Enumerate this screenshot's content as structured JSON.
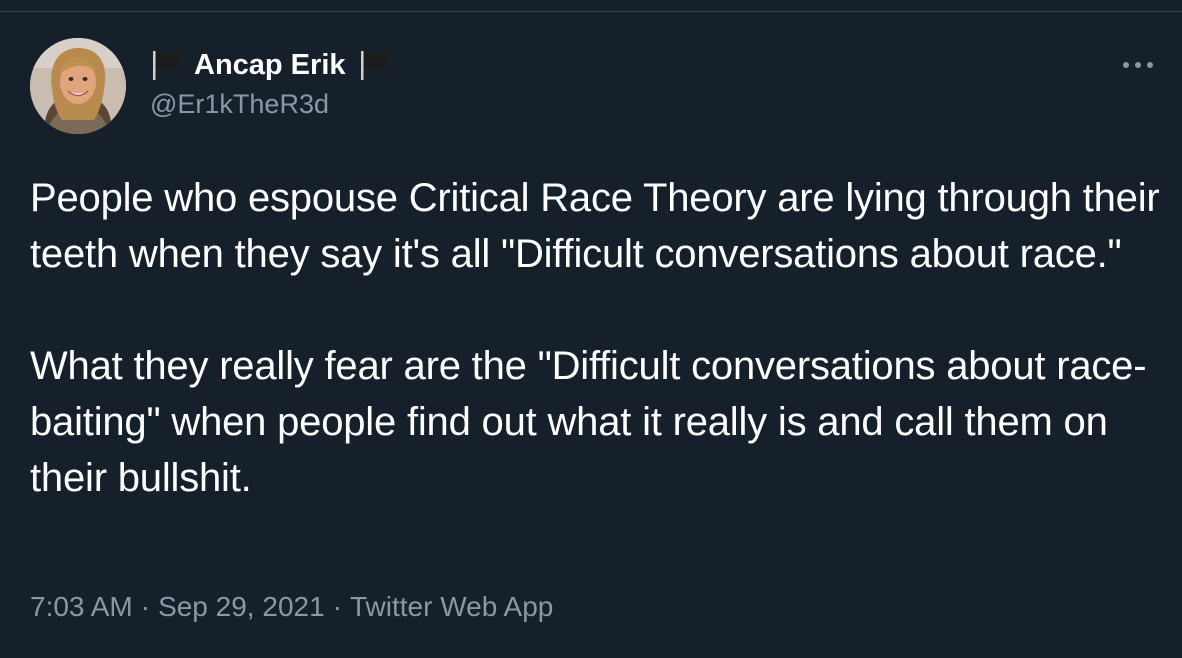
{
  "author": {
    "display_name": "Ancap Erik",
    "handle": "@Er1kTheR3d",
    "name_icons": [
      "black-flag-icon",
      "black-flag-icon"
    ]
  },
  "tweet": {
    "paragraphs": [
      "People who espouse Critical Race Theory are lying through their teeth when they say it's all \"Difficult conversations about race.\"",
      "What they really fear are the \"Difficult conversations about race-baiting\" when people find out what it really is and call them on their bullshit."
    ]
  },
  "meta": {
    "time": "7:03 AM",
    "separator": "·",
    "date": "Sep 29, 2021",
    "source": "Twitter Web App"
  },
  "colors": {
    "background": "#15202b",
    "text": "#ffffff",
    "secondary_text": "#8899a6",
    "divider": "#38444d"
  }
}
